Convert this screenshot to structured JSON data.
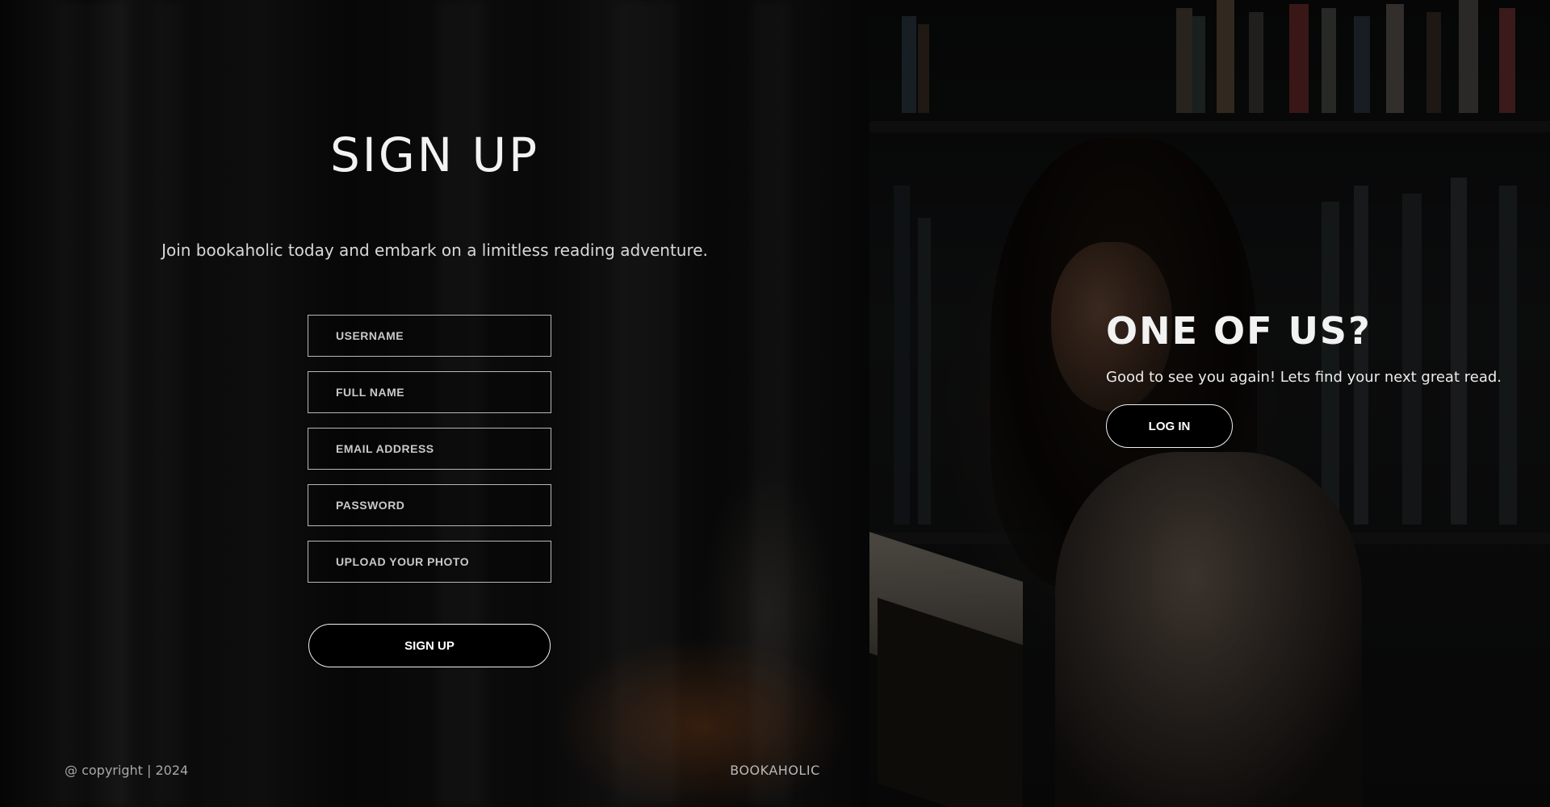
{
  "signup": {
    "title": "SIGN UP",
    "subtitle": "Join bookaholic today and embark on a limitless reading adventure.",
    "fields": {
      "username": "USERNAME",
      "full_name": "FULL NAME",
      "email": "EMAIL ADDRESS",
      "password": "PASSWORD",
      "photo": "UPLOAD YOUR PHOTO"
    },
    "button_label": "SIGN UP"
  },
  "login_panel": {
    "title": "ONE OF US?",
    "text": "Good to see you again! Lets find your next great read.",
    "button_label": "LOG IN"
  },
  "footer": {
    "copyright": "@ copyright | 2024",
    "brand": "BOOKAHOLIC"
  }
}
